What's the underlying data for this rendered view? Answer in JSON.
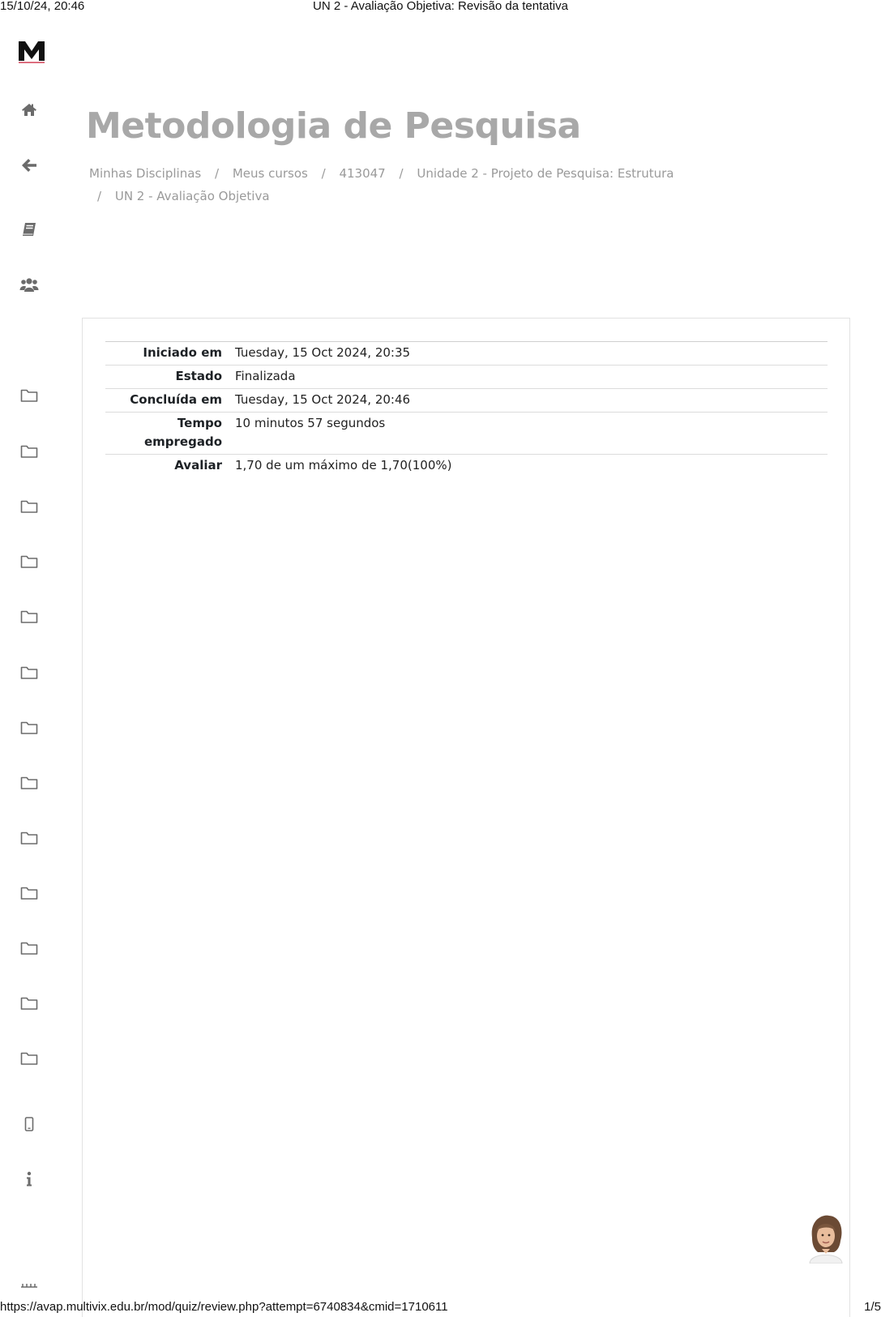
{
  "print": {
    "datetime": "15/10/24, 20:46",
    "title": "UN 2 - Avaliação Objetiva: Revisão da tentativa",
    "url": "https://avap.multivix.edu.br/mod/quiz/review.php?attempt=6740834&cmid=1710611",
    "page": "1/5"
  },
  "sidebar": {
    "icons": [
      "logo-m",
      "home-icon",
      "back-arrow-icon",
      "book-icon",
      "users-icon",
      "folder-icon",
      "folder-icon",
      "folder-icon",
      "folder-icon",
      "folder-icon",
      "folder-icon",
      "folder-icon",
      "folder-icon",
      "folder-icon",
      "folder-icon",
      "folder-icon",
      "folder-icon",
      "folder-icon",
      "mobile-icon",
      "info-icon"
    ]
  },
  "header": {
    "course_title": "Metodologia de Pesquisa"
  },
  "breadcrumb": {
    "items": [
      "Minhas Disciplinas",
      "Meus cursos",
      "413047",
      "Unidade 2 - Projeto de Pesquisa: Estrutura",
      "UN 2 - Avaliação Objetiva"
    ],
    "separator": "/"
  },
  "summary": {
    "rows": [
      {
        "label": "Iniciado em",
        "value": "Tuesday, 15 Oct 2024, 20:35"
      },
      {
        "label": "Estado",
        "value": "Finalizada"
      },
      {
        "label": "Concluída em",
        "value": "Tuesday, 15 Oct 2024, 20:46"
      },
      {
        "label": "Tempo empregado",
        "value": "10 minutos 57 segundos"
      },
      {
        "label": "Avaliar",
        "value": "1,70 de um máximo de 1,70(100%)"
      }
    ]
  },
  "colors": {
    "title": "#a8a8a8",
    "breadcrumb": "#9a9a9a",
    "icon": "#6b6b6b",
    "logo": "#111111"
  }
}
